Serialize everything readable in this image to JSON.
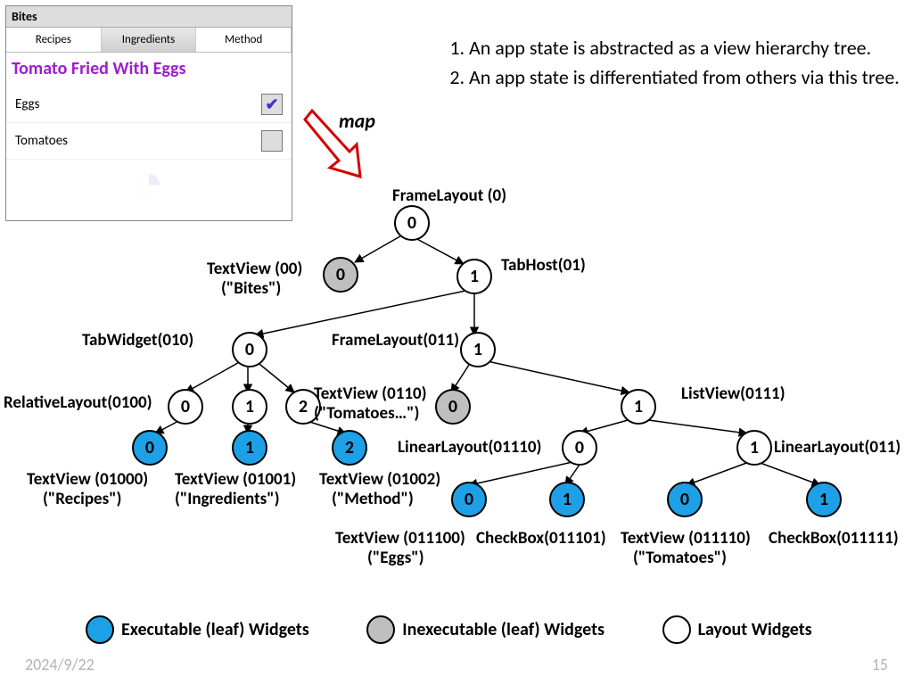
{
  "footer": {
    "date": "2024/9/22",
    "page": "15"
  },
  "screenshot": {
    "appTitle": "Bites",
    "tabs": [
      "Recipes",
      "Ingredients",
      "Method"
    ],
    "activeTabIndex": 1,
    "recipeTitle": "Tomato Fried With Eggs",
    "rows": [
      {
        "label": "Eggs",
        "checked": true
      },
      {
        "label": "Tomatoes",
        "checked": false
      }
    ]
  },
  "mapLabel": "map",
  "bullets": [
    "An app state is abstracted as a view hierarchy tree.",
    "An app state is differentiated from others via this tree."
  ],
  "legend": {
    "exec": "Executable (leaf) Widgets",
    "noex": "Inexecutable (leaf) Widgets",
    "layout": "Layout Widgets"
  },
  "tree": {
    "rootLabel": "FrameLayout (0)",
    "n00_label_a": "TextView (00)",
    "n00_label_b": "(\"Bites\")",
    "n01_label": "TabHost(01)",
    "n010_label": "TabWidget(010)",
    "n011_label": "FrameLayout(011)",
    "n0100_label": "RelativeLayout(0100)",
    "n0110_lblA": "TextView (0110)",
    "n0110_lblB": "(\"Tomatoes…\")",
    "n0111_label": "ListView(0111)",
    "n01110_label": "LinearLayout(01110)",
    "n01111_label": "LinearLayout(011)",
    "n01000_a": "TextView (01000)",
    "n01000_b": "(\"Recipes\")",
    "n01001_a": "TextView (01001)",
    "n01001_b": "(\"Ingredients\")",
    "n01002_a": "TextView (01002)",
    "n01002_b": "(\"Method\")",
    "n011100_a": "TextView (011100)",
    "n011100_b": "(\"Eggs\")",
    "n011101": "CheckBox(011101)",
    "n011110_a": "TextView (011110)",
    "n011110_b": "(\"Tomatoes\")",
    "n011111": "CheckBox(011111)"
  },
  "digits": {
    "d0": "0",
    "d1": "1",
    "d2": "2"
  }
}
